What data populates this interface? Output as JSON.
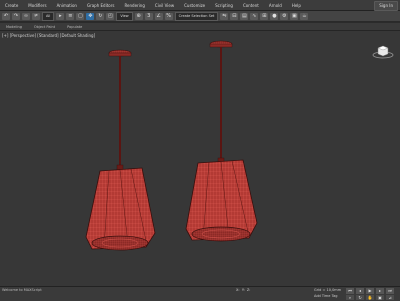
{
  "menu": [
    "Create",
    "Modifiers",
    "Animation",
    "Graph Editors",
    "Rendering",
    "Civil View",
    "Customize",
    "Scripting",
    "Content",
    "Arnold",
    "Help"
  ],
  "signin": "Sign In",
  "toolbar": {
    "select_filter": "All",
    "view_mode": "View",
    "selection_set": "Create Selection Set"
  },
  "ribbon_tabs": [
    "Modeling",
    "Object Paint",
    "Populate"
  ],
  "viewport": {
    "label": "[+] [Perspective] [Standard] [Default Shading]",
    "wire_color": "#e0504a",
    "shade_color": "#b8403a"
  },
  "status": {
    "left_text": "Welcome to MAXScript",
    "x": "X:",
    "y": "Y:",
    "z": "Z:",
    "grid": "Grid = 10,0mm",
    "add_time_tag": "Add Time Tag"
  }
}
